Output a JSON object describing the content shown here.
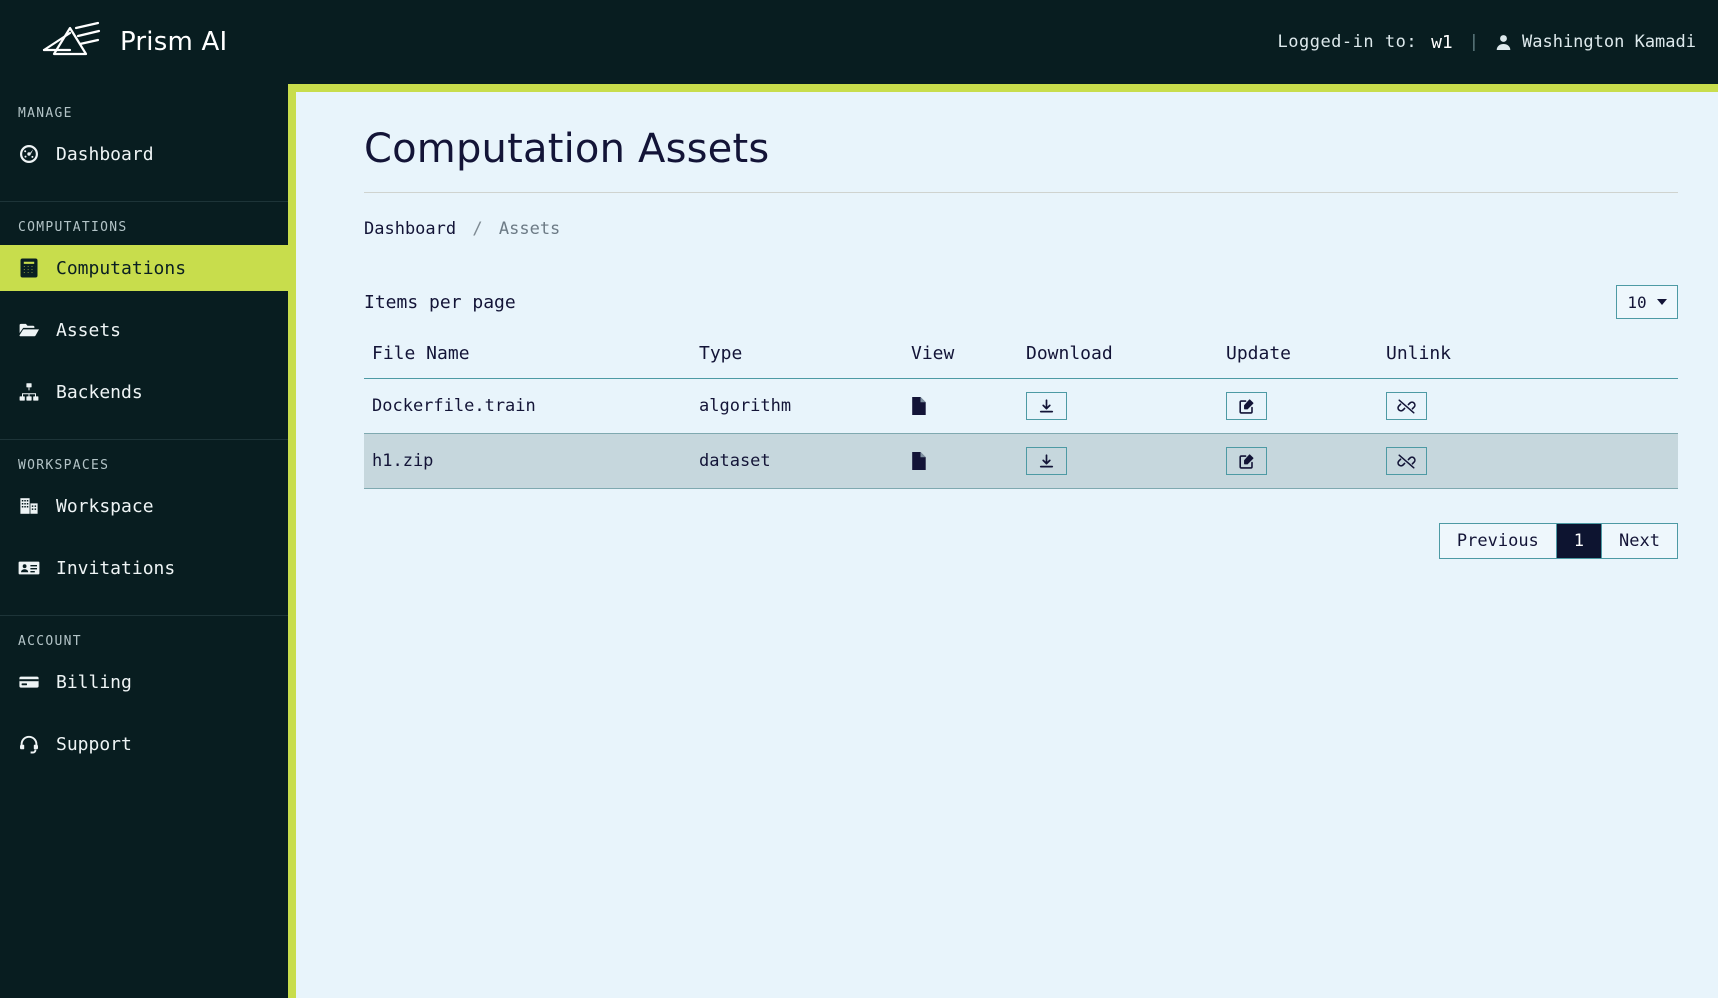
{
  "brand": {
    "name": "Prism AI",
    "logo_icon": "prism-logo-icon"
  },
  "topbar": {
    "logged_in_label": "Logged-in to:",
    "workspace": "w1",
    "separator": "|",
    "user_name": "Washington Kamadi",
    "user_icon": "user-icon"
  },
  "sidebar": {
    "groups": [
      {
        "heading": "MANAGE",
        "items": [
          {
            "label": "Dashboard",
            "icon": "gauge-icon",
            "active": false
          }
        ]
      },
      {
        "heading": "COMPUTATIONS",
        "items": [
          {
            "label": "Computations",
            "icon": "calculator-icon",
            "active": true
          },
          {
            "label": "Assets",
            "icon": "folder-open-icon",
            "active": false
          },
          {
            "label": "Backends",
            "icon": "sitemap-icon",
            "active": false
          }
        ]
      },
      {
        "heading": "WORKSPACES",
        "items": [
          {
            "label": "Workspace",
            "icon": "building-icon",
            "active": false
          },
          {
            "label": "Invitations",
            "icon": "id-card-icon",
            "active": false
          }
        ]
      },
      {
        "heading": "ACCOUNT",
        "items": [
          {
            "label": "Billing",
            "icon": "credit-card-icon",
            "active": false
          },
          {
            "label": "Support",
            "icon": "headset-icon",
            "active": false
          }
        ]
      }
    ]
  },
  "page": {
    "title": "Computation Assets",
    "breadcrumb": {
      "parent": "Dashboard",
      "separator": "/",
      "current": "Assets"
    }
  },
  "toolbar": {
    "items_per_page_label": "Items per page",
    "items_per_page_value": "10",
    "items_per_page_options": [
      "10"
    ]
  },
  "table": {
    "columns": [
      "File Name",
      "Type",
      "View",
      "Download",
      "Update",
      "Unlink"
    ],
    "rows": [
      {
        "file_name": "Dockerfile.train",
        "type": "algorithm",
        "view_icon": "file-icon",
        "download_icon": "download-icon",
        "update_icon": "edit-pencil-icon",
        "unlink_icon": "unlink-icon",
        "selected": false
      },
      {
        "file_name": "h1.zip",
        "type": "dataset",
        "view_icon": "file-icon",
        "download_icon": "download-icon",
        "update_icon": "edit-pencil-icon",
        "unlink_icon": "unlink-icon",
        "selected": true
      }
    ]
  },
  "pagination": {
    "previous_label": "Previous",
    "current_page": "1",
    "next_label": "Next"
  },
  "colors": {
    "dark": "#081d20",
    "accent_lime": "#c8dd4c",
    "content_bg": "#e8f4fb",
    "border_teal": "#4d9aa4",
    "row_selected": "#c6d7dd",
    "text_dark": "#131437",
    "pager_active_bg": "#0d1430"
  }
}
